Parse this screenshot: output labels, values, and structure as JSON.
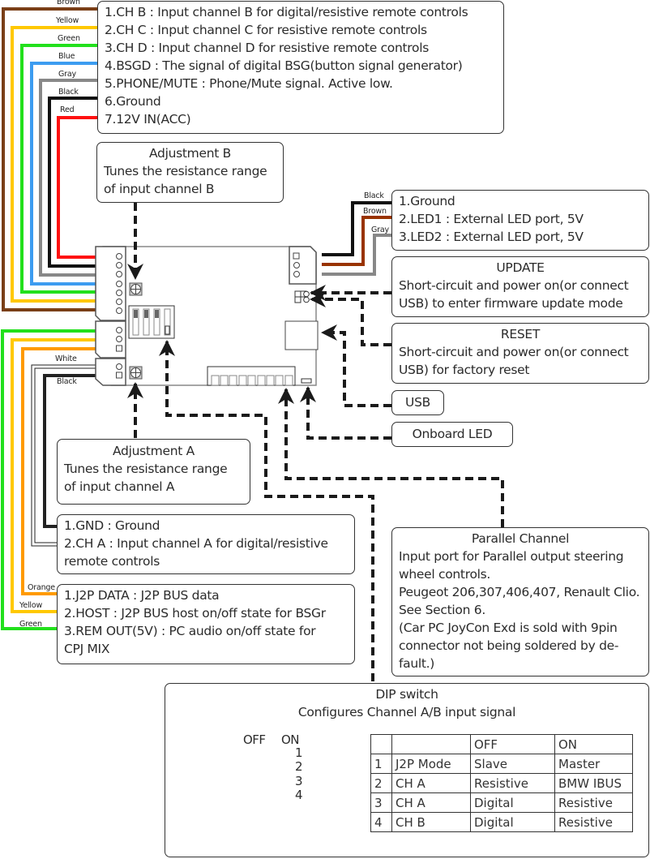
{
  "main_connector": {
    "lines": [
      "1.CH B : Input channel B for digital/resistive remote controls",
      "2.CH C : Input channel C for resistive remote controls",
      "3.CH D : Input channel D for resistive remote controls",
      "4.BSGD : The signal of digital BSG(button signal generator)",
      "5.PHONE/MUTE : Phone/Mute signal. Active low.",
      "6.Ground",
      "7.12V IN(ACC)"
    ],
    "wires": [
      {
        "label": "Brown",
        "color": "#7a3f17"
      },
      {
        "label": "Yellow",
        "color": "#ffc800"
      },
      {
        "label": "Green",
        "color": "#22e01c"
      },
      {
        "label": "Blue",
        "color": "#3c9cf0"
      },
      {
        "label": "Gray",
        "color": "#888888"
      },
      {
        "label": "Black",
        "color": "#111111"
      },
      {
        "label": "Red",
        "color": "#ff1010"
      }
    ]
  },
  "adjustment_b": {
    "title": "Adjustment B",
    "lines": [
      "Tunes the resistance range",
      "of input channel B"
    ]
  },
  "led_connector": {
    "lines": [
      "1.Ground",
      "2.LED1 : External LED port, 5V",
      "3.LED2 : External LED port, 5V"
    ],
    "wires": [
      {
        "label": "Black",
        "color": "#111111"
      },
      {
        "label": "Brown",
        "color": "#993300"
      },
      {
        "label": "Gray",
        "color": "#888888"
      }
    ]
  },
  "update": {
    "title": "UPDATE",
    "lines": [
      "Short-circuit and power on(or connect",
      "USB) to enter firmware update mode"
    ]
  },
  "reset": {
    "title": "RESET",
    "lines": [
      "Short-circuit and power on(or connect",
      "USB) for factory reset"
    ]
  },
  "usb": {
    "label": "USB"
  },
  "onboard_led": {
    "label": "Onboard LED"
  },
  "adjustment_a": {
    "title": "Adjustment A",
    "lines": [
      "Tunes the resistance range",
      "of input channel A"
    ]
  },
  "channel_a_connector": {
    "lines": [
      "1.GND : Ground",
      "2.CH A : Input channel A for digital/resistive",
      "remote controls"
    ],
    "wires": [
      {
        "label": "White",
        "color": "#ffffff"
      },
      {
        "label": "Black",
        "color": "#222222"
      }
    ]
  },
  "j2p_connector": {
    "lines": [
      "1.J2P DATA : J2P BUS data",
      "2.HOST : J2P BUS host on/off state for BSGr",
      "3.REM OUT(5V) : PC audio on/off state for",
      "CPJ MIX"
    ],
    "wires": [
      {
        "label": "Orange",
        "color": "#ff9a00"
      },
      {
        "label": "Yellow",
        "color": "#ffc800"
      },
      {
        "label": "Green",
        "color": "#22e01c"
      }
    ]
  },
  "parallel_channel": {
    "title": "Parallel Channel",
    "lines": [
      "Input port for Parallel output steering",
      "wheel controls.",
      "Peugeot 206,307,406,407, Renault Clio.",
      "See Section 6.",
      "(Car PC JoyCon Exd is sold with 9pin",
      "connector not being soldered by de-",
      "fault.)"
    ]
  },
  "dip_switch": {
    "title": "DIP switch",
    "subtitle": "Configures Channel A/B input signal",
    "off_label": "OFF",
    "on_label": "ON",
    "switches": [
      {
        "number": "1",
        "state": "ON"
      },
      {
        "number": "2",
        "state": "OFF"
      },
      {
        "number": "3",
        "state": "ON"
      },
      {
        "number": "4",
        "state": "ON"
      }
    ],
    "table": {
      "header": [
        "",
        "",
        "OFF",
        "ON"
      ],
      "rows": [
        [
          "1",
          "J2P Mode",
          "Slave",
          "Master"
        ],
        [
          "2",
          "CH A",
          "Resistive",
          "BMW IBUS"
        ],
        [
          "3",
          "CH A",
          "Digital",
          "Resistive"
        ],
        [
          "4",
          "CH B",
          "Digital",
          "Resistive"
        ]
      ]
    }
  },
  "colors": {
    "box_border": "#333333",
    "dashed_leader": "#1a1a1a",
    "board_outline": "#888888"
  }
}
